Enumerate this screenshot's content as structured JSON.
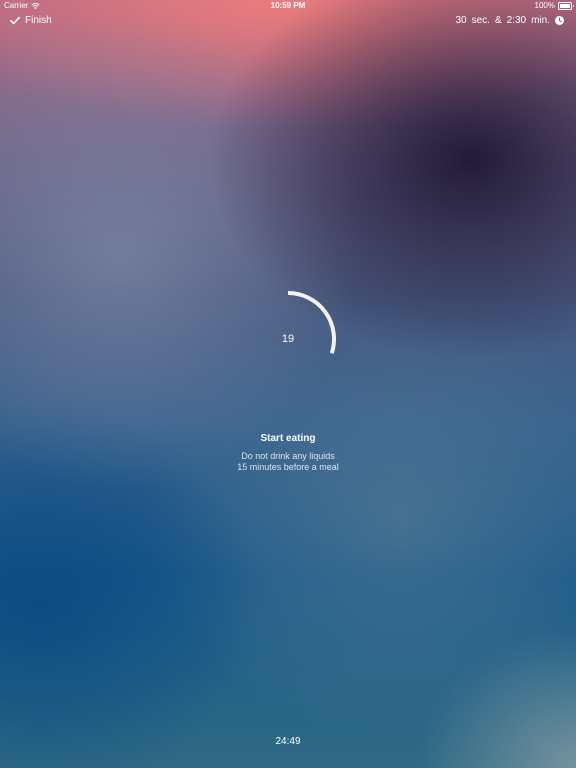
{
  "status_bar": {
    "carrier": "Carrier",
    "time": "10:59 PM",
    "battery": "100%"
  },
  "toolbar": {
    "finish_label": "Finish",
    "sec_value": "30",
    "sec_unit": "sec.",
    "separator": "&",
    "min_value": "2:30",
    "min_unit": "min."
  },
  "timer": {
    "value": "19",
    "progress_fraction": 0.3,
    "ring_color": "#f2f2f4"
  },
  "instruction": {
    "title": "Start eating",
    "lines": [
      "Do not drink any liquids",
      "15 minutes before a meal"
    ]
  },
  "footer": {
    "elapsed": "24:49"
  },
  "icons": {
    "signal": "wifi-icon",
    "battery": "battery-icon",
    "finish": "check-icon",
    "durations": "clock-icon"
  }
}
